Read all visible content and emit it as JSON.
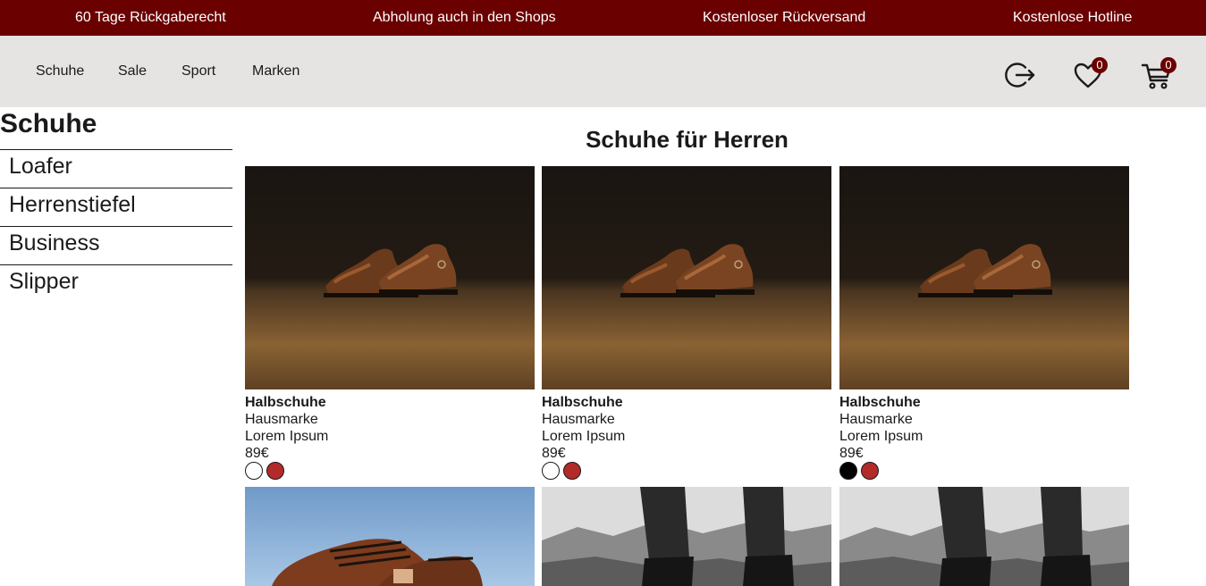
{
  "promo": [
    "60 Tage Rückgaberecht",
    "Abholung auch in den Shops",
    "Kostenloser Rückversand",
    "Kostenlose Hotline"
  ],
  "nav": {
    "links": [
      "Schuhe",
      "Sale",
      "Sport",
      "Marken"
    ],
    "wishlist_count": "0",
    "cart_count": "0",
    "icons": [
      "logout-icon",
      "heart-icon",
      "cart-icon"
    ]
  },
  "sidebar": {
    "title": "Schuhe",
    "items": [
      "Loafer",
      "Herrenstiefel",
      "Business",
      "Slipper"
    ]
  },
  "page": {
    "heading": "Schuhe für Herren"
  },
  "colors": {
    "brand": "#6b0000",
    "nav_background": "#e6e3e3",
    "swatch_red": "#b22a2a",
    "swatch_white": "#ffffff",
    "swatch_black": "#000000"
  },
  "products": [
    {
      "name": "Halbschuhe",
      "brand": "Hausmarke",
      "description": "Lorem Ipsum",
      "price": "89€",
      "colors": [
        "#ffffff",
        "#b22a2a"
      ]
    },
    {
      "name": "Halbschuhe",
      "brand": "Hausmarke",
      "description": "Lorem Ipsum",
      "price": "89€",
      "colors": [
        "#ffffff",
        "#b22a2a"
      ]
    },
    {
      "name": "Halbschuhe",
      "brand": "Hausmarke",
      "description": "Lorem Ipsum",
      "price": "89€",
      "colors": [
        "#000000",
        "#b22a2a"
      ]
    }
  ]
}
